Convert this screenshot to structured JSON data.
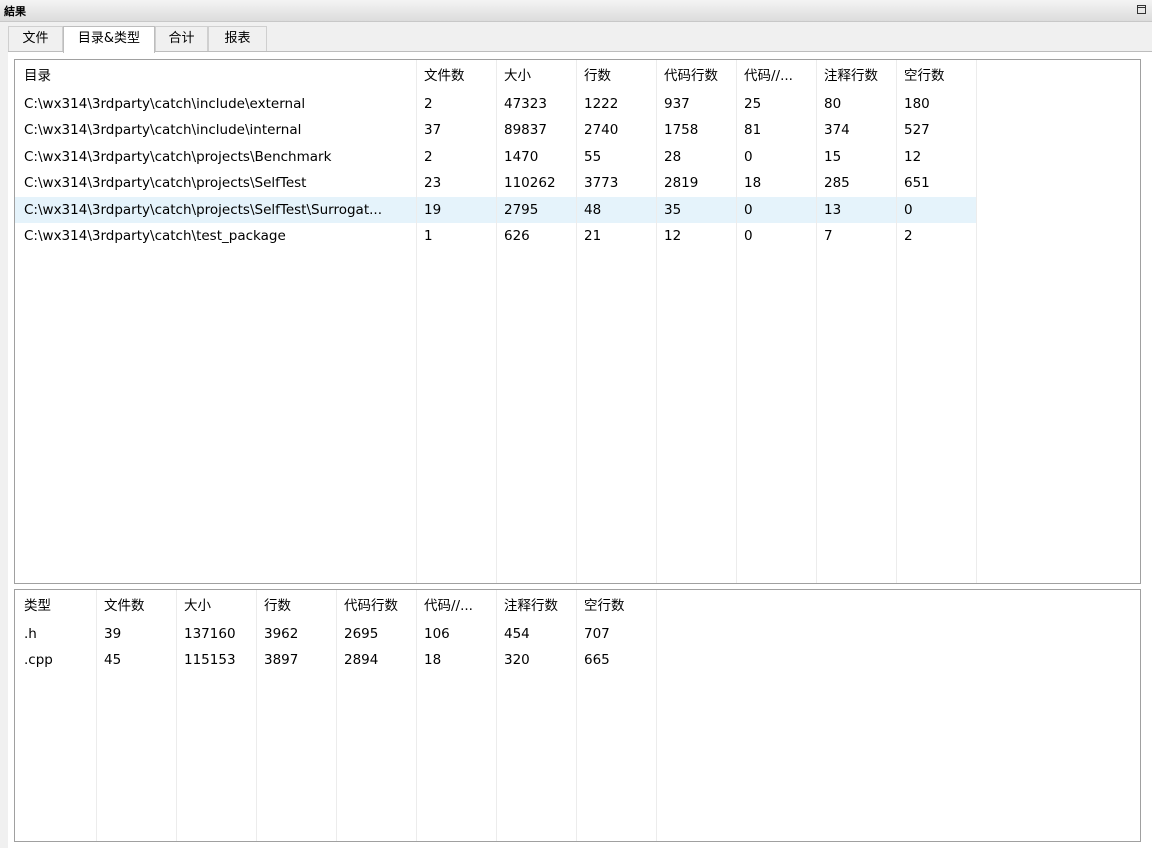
{
  "window": {
    "title": "結果"
  },
  "tabs": [
    {
      "label": "文件"
    },
    {
      "label": "目录&类型"
    },
    {
      "label": "合计"
    },
    {
      "label": "报表"
    }
  ],
  "directory_table": {
    "columns": [
      "目录",
      "文件数",
      "大小",
      "行数",
      "代码行数",
      "代码//...",
      "注释行数",
      "空行数"
    ],
    "rows": [
      [
        "C:\\wx314\\3rdparty\\catch\\include\\external",
        "2",
        "47323",
        "1222",
        "937",
        "25",
        "80",
        "180"
      ],
      [
        "C:\\wx314\\3rdparty\\catch\\include\\internal",
        "37",
        "89837",
        "2740",
        "1758",
        "81",
        "374",
        "527"
      ],
      [
        "C:\\wx314\\3rdparty\\catch\\projects\\Benchmark",
        "2",
        "1470",
        "55",
        "28",
        "0",
        "15",
        "12"
      ],
      [
        "C:\\wx314\\3rdparty\\catch\\projects\\SelfTest",
        "23",
        "110262",
        "3773",
        "2819",
        "18",
        "285",
        "651"
      ],
      [
        "C:\\wx314\\3rdparty\\catch\\projects\\SelfTest\\Surrogat...",
        "19",
        "2795",
        "48",
        "35",
        "0",
        "13",
        "0"
      ],
      [
        "C:\\wx314\\3rdparty\\catch\\test_package",
        "1",
        "626",
        "21",
        "12",
        "0",
        "7",
        "2"
      ]
    ],
    "selected_row": 4
  },
  "type_table": {
    "columns": [
      "类型",
      "文件数",
      "大小",
      "行数",
      "代码行数",
      "代码//...",
      "注释行数",
      "空行数"
    ],
    "rows": [
      [
        ".h",
        "39",
        "137160",
        "3962",
        "2695",
        "106",
        "454",
        "707"
      ],
      [
        ".cpp",
        "45",
        "115153",
        "3897",
        "2894",
        "18",
        "320",
        "665"
      ]
    ]
  },
  "colors": {
    "selection": "#e5f3fb",
    "grid_line": "#ececec",
    "border": "#a0a0a0"
  }
}
